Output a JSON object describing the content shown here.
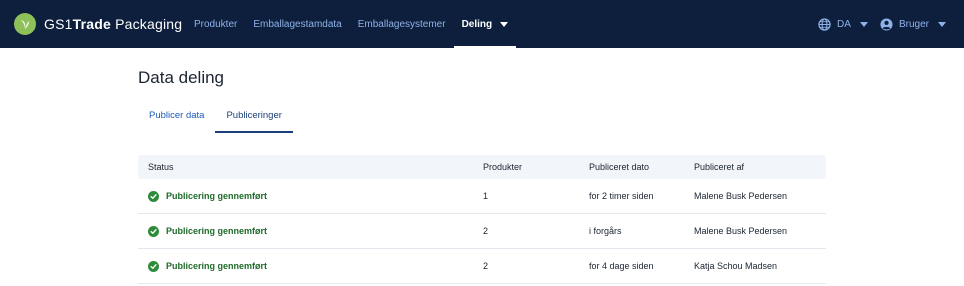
{
  "brand": {
    "prefix": "GS1",
    "bold": "Trade",
    "suffix": " Packaging"
  },
  "nav": {
    "items": [
      {
        "label": "Produkter"
      },
      {
        "label": "Emballagestamdata"
      },
      {
        "label": "Emballagesystemer"
      },
      {
        "label": "Deling"
      }
    ],
    "language": "DA",
    "user": "Bruger"
  },
  "page": {
    "title": "Data deling"
  },
  "tabs": [
    {
      "label": "Publicer data"
    },
    {
      "label": "Publiceringer"
    }
  ],
  "table": {
    "headers": [
      "Status",
      "Produkter",
      "Publiceret dato",
      "Publiceret af"
    ],
    "rows": [
      {
        "status": "Publicering gennemført",
        "products": "1",
        "date": "for 2 timer siden",
        "by": "Malene Busk Pedersen"
      },
      {
        "status": "Publicering gennemført",
        "products": "2",
        "date": "i forgårs",
        "by": "Malene Busk Pedersen"
      },
      {
        "status": "Publicering gennemført",
        "products": "2",
        "date": "for 4 dage siden",
        "by": "Katja Schou Madsen"
      }
    ]
  },
  "colors": {
    "topbar": "#0d1f3d",
    "nav_link": "#8fb2e6",
    "tab_link": "#1e5bb8",
    "success": "#2e8b3a",
    "brand_logo": "#8ec05a"
  }
}
